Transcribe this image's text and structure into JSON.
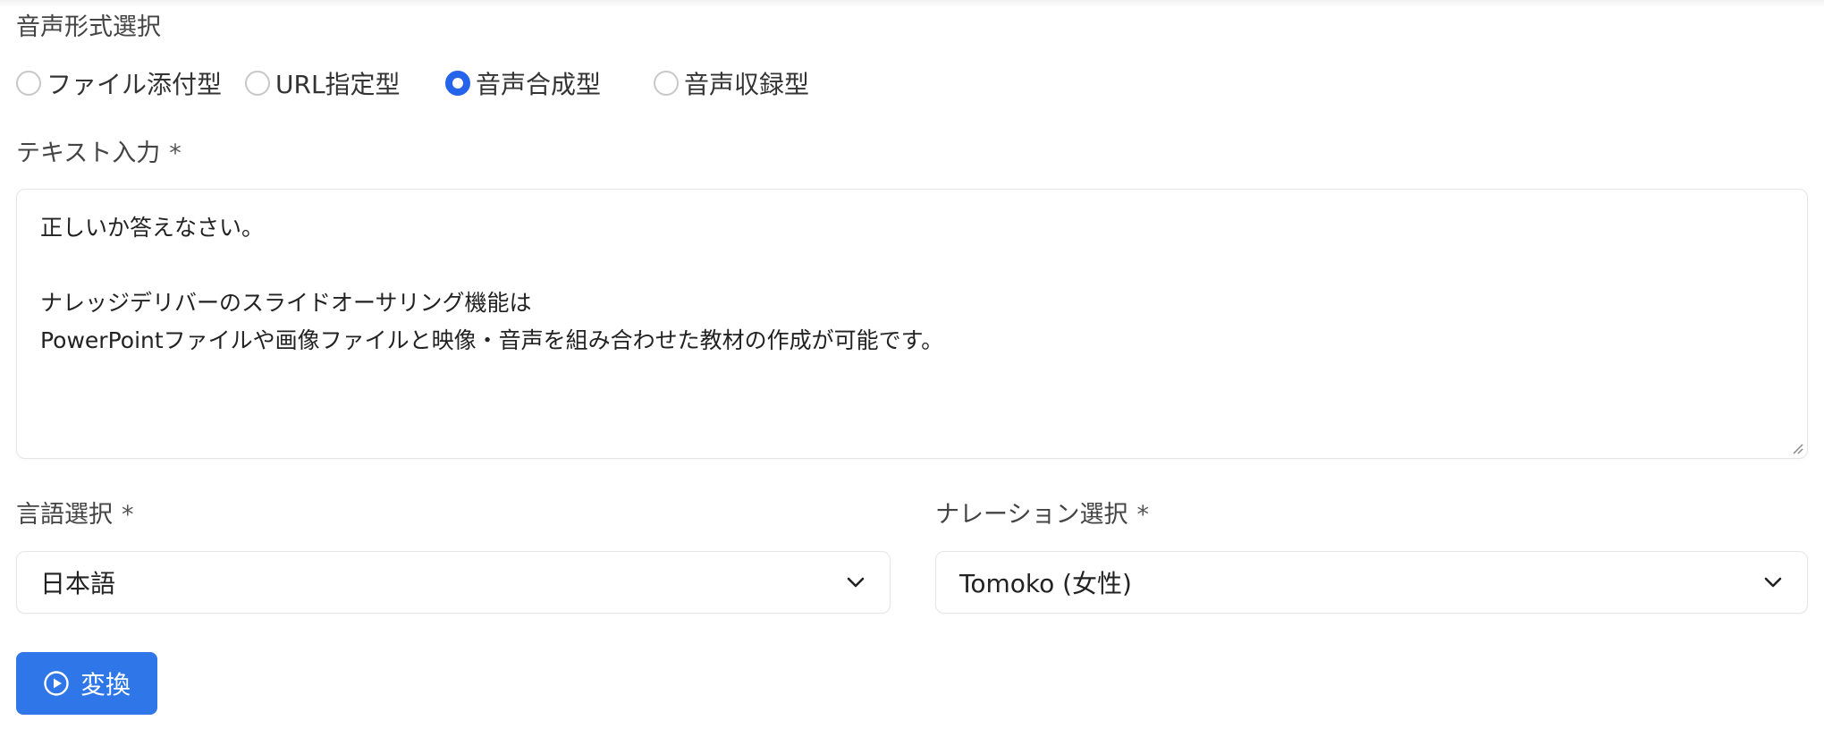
{
  "audio_format": {
    "label": "音声形式選択",
    "options": [
      {
        "label": "ファイル添付型",
        "checked": false
      },
      {
        "label": "URL指定型",
        "checked": false
      },
      {
        "label": "音声合成型",
        "checked": true
      },
      {
        "label": "音声収録型",
        "checked": false
      }
    ]
  },
  "text_input": {
    "label": "テキスト入力",
    "required_mark": "*",
    "lines": [
      "正しいか答えなさい。",
      "",
      "ナレッジデリバーのスライドオーサリング機能は",
      "PowerPointファイルや画像ファイルと映像・音声を組み合わせた教材の作成が可能です。"
    ]
  },
  "language": {
    "label": "言語選択",
    "required_mark": "*",
    "value": "日本語"
  },
  "narration": {
    "label": "ナレーション選択",
    "required_mark": "*",
    "value": "Tomoko (女性)"
  },
  "convert_button": {
    "label": "変換",
    "icon": "play-circle-icon"
  },
  "colors": {
    "accent": "#2563eb",
    "button": "#2f76e8"
  }
}
